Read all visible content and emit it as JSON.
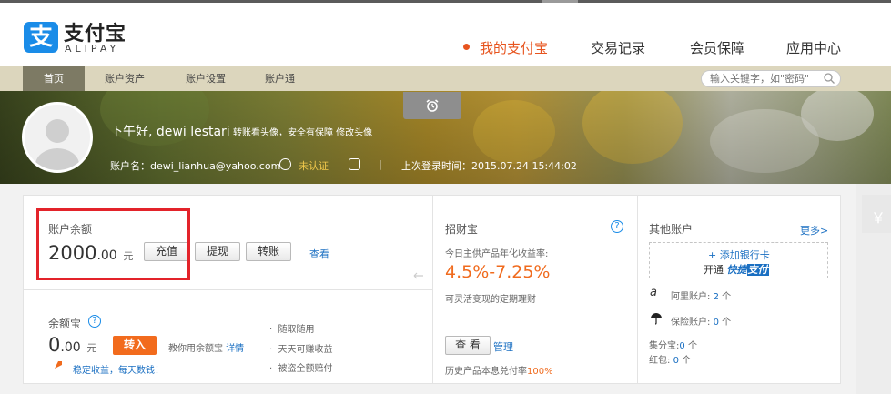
{
  "brand": {
    "name": "支付宝",
    "sub": "ALIPAY"
  },
  "main_nav": [
    {
      "label": "我的支付宝",
      "active": true
    },
    {
      "label": "交易记录"
    },
    {
      "label": "会员保障"
    },
    {
      "label": "应用中心"
    }
  ],
  "sub_nav": [
    "首页",
    "账户资产",
    "账户设置",
    "账户通"
  ],
  "search": {
    "placeholder": "输入关键字，如\"密码\""
  },
  "user": {
    "greeting": "下午好, dewi lestari",
    "links": "转账看头像，安全有保障 修改头像",
    "account_label": "账户名：",
    "account": "dewi_lianhua@yahoo.com",
    "verify_status": "未认证",
    "separator": "|",
    "last_login": "上次登录时间：2015.07.24 15:44:02"
  },
  "balance": {
    "label": "账户余额",
    "amount": "2000",
    "decimals": ".00",
    "unit": "元",
    "buttons": [
      "充值",
      "提现",
      "转账"
    ],
    "view": "查看"
  },
  "yuebao": {
    "label": "余额宝",
    "amount": "0",
    "decimals": ".00",
    "unit": "元",
    "transfer_in": "转入",
    "teach": "教你用余额宝",
    "details": "详情",
    "promo": "稳定收益，每天数钱！",
    "features": [
      "随取随用",
      "天天可赚收益",
      "被盗全额赔付"
    ]
  },
  "zhaocaibao": {
    "label": "招财宝",
    "subtitle": "今日主供产品年化收益率:",
    "rate": "4.5%-7.25%",
    "desc": "可灵活变现的定期理财",
    "view": "查 看",
    "manage": "管理",
    "history_prefix": "历史产品本息兑付率",
    "history_rate": "100%"
  },
  "other": {
    "label": "其他账户",
    "more": "更多>",
    "add_bank": "+ 添加银行卡",
    "quickpay_prefix": "开通",
    "quickpay_a": "快捷",
    "quickpay_b": "支付",
    "aliyun": "阿里账户:",
    "aliyun_count": "2",
    "insurance": "保险账户:",
    "insurance_count": "0",
    "jifenbao": "集分宝:",
    "jifenbao_count": "0",
    "hongbao": "红包:",
    "hongbao_count": "0",
    "unit": "个"
  },
  "side": {
    "icon": "￥"
  },
  "colors": {
    "accent": "#e7541e",
    "brand": "#1a8ce8",
    "link": "#1a6fc2"
  }
}
